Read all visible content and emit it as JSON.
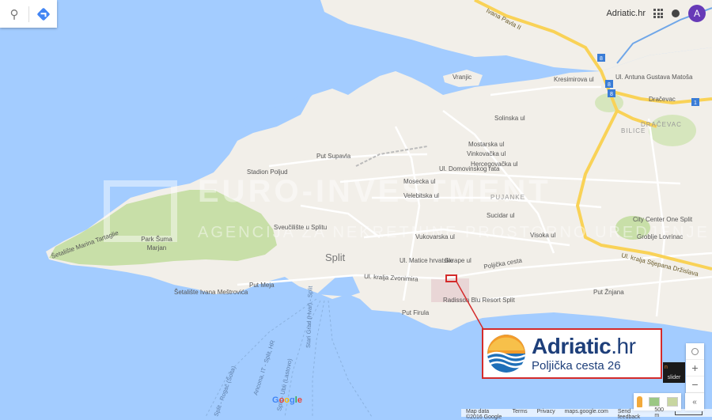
{
  "top_bar": {
    "search_icon": "search-icon",
    "directions_icon": "directions-icon",
    "brand": "Adriatic.hr",
    "account_initial": "A"
  },
  "watermark": {
    "line1": "EURO-INVESTMENT",
    "line2": "AGENCIJA ZA NEKRETNINE PROSTORNO UREDJENJE"
  },
  "map_labels": {
    "city": "Split",
    "stadion": "Stadion Poljud",
    "park": "Park Šuma Marjan",
    "park_line1": "Park Šuma",
    "park_line2": "Marjan",
    "sveuciliste": "Sveučilište u Splitu",
    "radisson": "Radisson Blu Resort Split",
    "city_center": "City Center One Split",
    "groblje": "Groblje Lovrinac",
    "vranjic": "Vranjic",
    "bilice": "BILICE",
    "dracevac_district": "DRAČEVAC",
    "dracevac": "Dračevac",
    "pujanke": "PUJANKE",
    "put_supavla": "Put Supavla",
    "put_meja": "Put Meja",
    "put_firula": "Put Firula",
    "put_znjana": "Put Žnjana",
    "setaliste_mestrovica": "Šetalište Ivana Meštrovića",
    "setaliste_tartaglie": "Šetalište Marina Tartaglie",
    "ul_zvonimira": "Ul. kralja Zvonimira",
    "poljicka": "Poljička cesta",
    "domovinskog": "Ul. Domovinskog rata",
    "stjepana": "Ul. kralja Stjepana Držislava",
    "ivana_pavla": "Ivana Pavla II",
    "matice": "Ul. Matice hrvatske",
    "skrape": "Skrape ul",
    "vukovarska": "Vukovarska ul",
    "solinska": "Solinska ul",
    "kresimirova": "Kresimirova ul",
    "matosa": "Ul. Antuna Gustava Matoša",
    "mostarska": "Mostarska ul",
    "vinkovacka": "Vinkovačka ul",
    "hercegovacka": "Hercegovačka ul",
    "mosecka": "Mosecka ul",
    "velebitska": "Velebitska ul",
    "sucidar": "Sucidar ul",
    "visoka": "Visoka ul",
    "ferry_ancona": "Ancona, IT - Split, HR",
    "ferry_ubli": "Split - Ubli (Lastovo)",
    "ferry_stari_grad": "Stari Grad (Hvar) - Split",
    "ferry_split_rogac": "Split - Rogač (Šolta)"
  },
  "highway_shields": [
    "1",
    "8",
    "8",
    "8"
  ],
  "callout": {
    "brand_bold": "Adriatic",
    "brand_light": ".hr",
    "address": "Poljička cesta 26"
  },
  "controls": {
    "zoom_in": "+",
    "zoom_out": "−",
    "expand": "«",
    "slider_label": "slider"
  },
  "footer": {
    "map_data": "Map data ©2016 Google",
    "terms": "Terms",
    "privacy": "Privacy",
    "maps_url": "maps.google.com",
    "feedback": "Send feedback",
    "scale": "500 m"
  },
  "google_logo": "Google",
  "colors": {
    "water": "#a3ccff",
    "land": "#f2efe9",
    "park": "#c8dfa8",
    "highway": "#f9d257",
    "marker": "#d42b2b",
    "brand_blue": "#1e3f7a",
    "avatar": "#673ab7"
  }
}
